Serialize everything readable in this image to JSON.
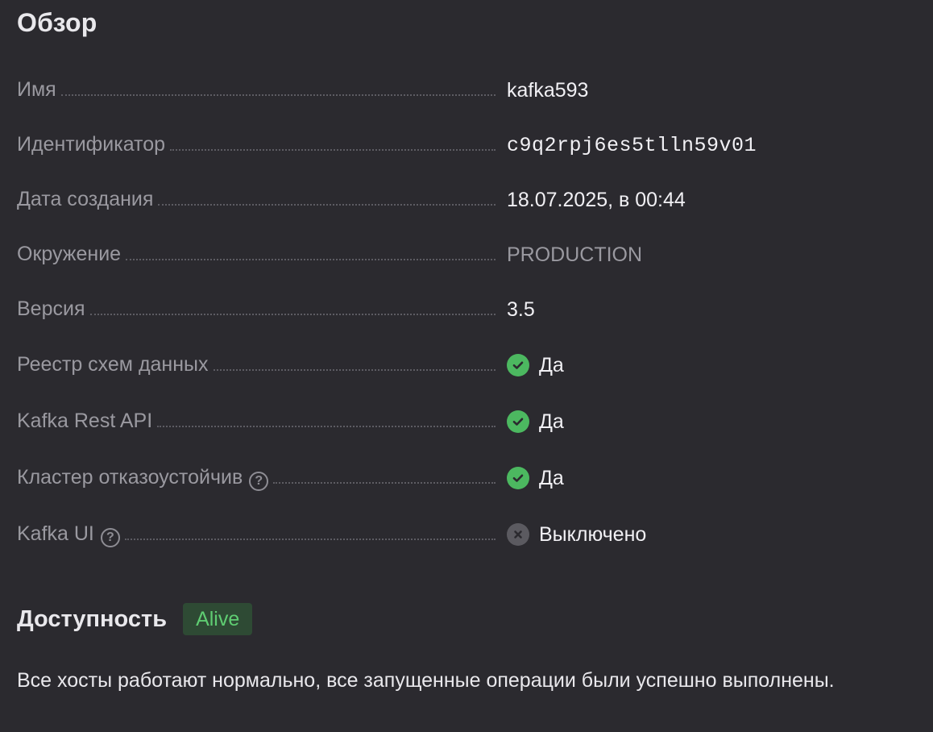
{
  "overview": {
    "title": "Обзор",
    "rows": [
      {
        "label": "Имя",
        "value": "kafka593"
      },
      {
        "label": "Идентификатор",
        "value": "c9q2rpj6es5tlln59v01"
      },
      {
        "label": "Дата создания",
        "value": "18.07.2025, в 00:44"
      },
      {
        "label": "Окружение",
        "value": "PRODUCTION"
      },
      {
        "label": "Версия",
        "value": "3.5"
      },
      {
        "label": "Реестр схем данных",
        "value": "Да",
        "icon": "check-circle-icon"
      },
      {
        "label": "Kafka Rest API",
        "value": "Да",
        "icon": "check-circle-icon"
      },
      {
        "label": "Кластер отказоустойчив",
        "value": "Да",
        "icon": "check-circle-icon",
        "help": "?"
      },
      {
        "label": "Kafka UI",
        "value": "Выключено",
        "icon": "cross-circle-icon",
        "help": "?"
      }
    ]
  },
  "availability": {
    "title": "Доступность",
    "status": "Alive",
    "description": "Все хосты работают нормально, все запущенные операции были успешно выполнены."
  },
  "colors": {
    "background": "#2b2a2f",
    "ok": "#4cb860",
    "badge_bg": "#2e4a34",
    "badge_text": "#5fcd72"
  }
}
